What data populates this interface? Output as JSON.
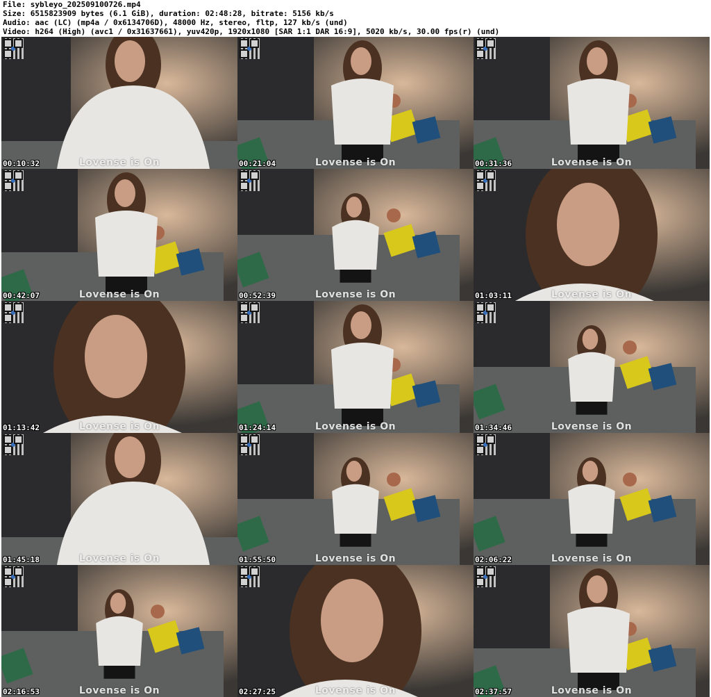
{
  "header": {
    "file": "File: sybleyo_202509100726.mp4",
    "size": "Size: 6515823909 bytes (6.1 GiB), duration: 02:48:28, bitrate: 5156 kb/s",
    "audio": "Audio: aac (LC) (mp4a / 0x6134706D), 48000 Hz, stereo, fltp, 127 kb/s (und)",
    "video": "Video: h264 (High) (avc1 / 0x31637661), yuv420p, 1920x1080 [SAR 1:1 DAR 16:9], 5020 kb/s, 30.00 fps(r) (und)"
  },
  "overlay_text": "Lovense is On",
  "thumbnails": [
    {
      "timestamp": "00:10:32",
      "view": "closeup"
    },
    {
      "timestamp": "00:21:04",
      "view": "mid"
    },
    {
      "timestamp": "00:31:36",
      "view": "mid"
    },
    {
      "timestamp": "00:42:07",
      "view": "mid"
    },
    {
      "timestamp": "00:52:39",
      "view": "wide"
    },
    {
      "timestamp": "01:03:11",
      "view": "face"
    },
    {
      "timestamp": "01:13:42",
      "view": "face"
    },
    {
      "timestamp": "01:24:14",
      "view": "mid"
    },
    {
      "timestamp": "01:34:46",
      "view": "wide"
    },
    {
      "timestamp": "01:45:18",
      "view": "closeup"
    },
    {
      "timestamp": "01:55:50",
      "view": "wide"
    },
    {
      "timestamp": "02:06:22",
      "view": "wide"
    },
    {
      "timestamp": "02:16:53",
      "view": "wide"
    },
    {
      "timestamp": "02:27:25",
      "view": "face"
    },
    {
      "timestamp": "02:37:57",
      "view": "mid"
    }
  ],
  "colors": {
    "wall": "#3a3734",
    "curtain": "#2b2b2d",
    "sofa": "#5d605f",
    "pillow_yellow": "#d8c81c",
    "pillow_blue": "#1f4f7a",
    "pillow_green": "#2e6a48",
    "hoodie": "#e8e6e3",
    "hair": "#4a3121",
    "skin": "#c99c84",
    "lamp_glow": "#d9b89a"
  }
}
